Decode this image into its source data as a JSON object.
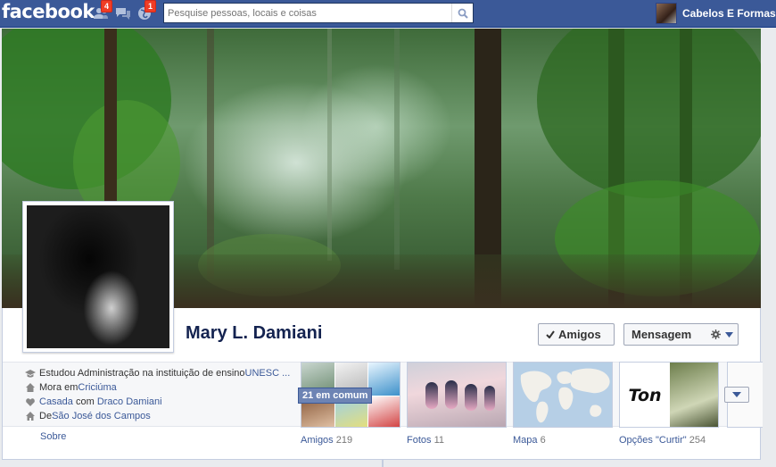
{
  "topbar": {
    "logo": "facebook",
    "friend_requests_count": "4",
    "notifications_count": "1",
    "search_placeholder": "Pesquise pessoas, locais e coisas",
    "account_name": "Cabelos E Formas"
  },
  "profile": {
    "name": "Mary L. Damiani",
    "friends_button": "Amigos",
    "message_button": "Mensagem"
  },
  "about": {
    "studied_prefix": "Estudou Administração na instituição de ensino ",
    "studied_link": "UNESC ...",
    "lives_prefix": "Mora em ",
    "lives_link": "Criciúma",
    "married_link1": "Casada",
    "married_middle": " com ",
    "married_link2": "Draco Damiani",
    "from_prefix": "De ",
    "from_link": "São José dos Campos",
    "about_link": "Sobre"
  },
  "tiles": {
    "friends_label": "Amigos",
    "friends_count": "219",
    "mutual_badge": "21 em comum",
    "photos_label": "Fotos",
    "photos_count": "11",
    "map_label": "Mapa",
    "map_count": "6",
    "likes_label": "Opções \"Curtir\"",
    "likes_count": "254",
    "likes_tile_text": "Ton"
  }
}
